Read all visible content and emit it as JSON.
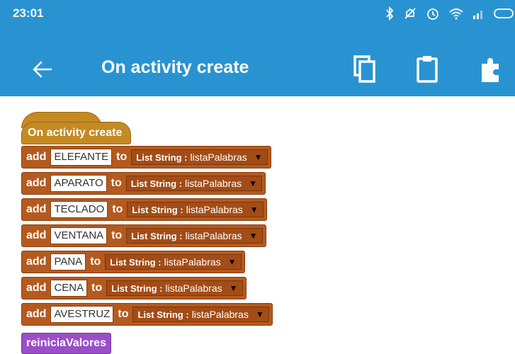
{
  "status_bar": {
    "time": "23:01",
    "icons": [
      "bluetooth-icon",
      "mute-icon",
      "alarm-icon",
      "wifi-icon",
      "signal-icon",
      "battery-icon"
    ]
  },
  "app_bar": {
    "title": "On activity create",
    "actions": [
      "copy-icon",
      "paste-icon",
      "puzzle-icon"
    ]
  },
  "colors": {
    "primary": "#2993d2",
    "event_block": "#c58a22",
    "statement_block": "#b55a1f",
    "variable_block": "#a34c16",
    "procedure_block": "#9b4fc7"
  },
  "blocks": {
    "event_label": "On activity create",
    "add_keyword": "add",
    "to_keyword": "to",
    "list_type": "List String :",
    "list_name": "listaPalabras",
    "items": [
      "ELEFANTE",
      "APARATO",
      "TECLADO",
      "VENTANA",
      "PANA",
      "CENA",
      "AVESTRUZ"
    ],
    "procedure": "reiniciaValores"
  }
}
